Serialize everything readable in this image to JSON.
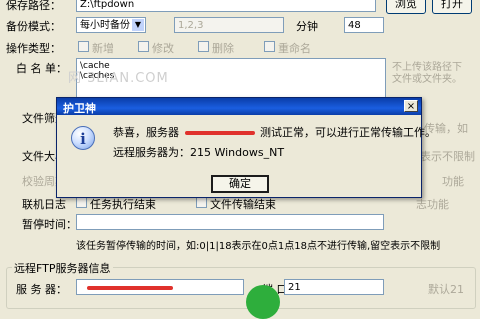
{
  "form": {
    "save_path_label": "保存路径：",
    "save_path_value": "Z:\\ftpdown",
    "browse_label": "浏览",
    "open_label": "打开",
    "backup_mode_label": "备份模式：",
    "backup_mode_value": "每小时备份",
    "backup_times_value": "1,2,3",
    "minute_label": "分钟",
    "minute_value": "48",
    "op_type_label": "操作类型：",
    "op_new": "新增",
    "op_modify": "修改",
    "op_delete": "删除",
    "op_rename": "重命名",
    "whitelist_label": "白 名 单：",
    "whitelist_lines": [
      "\\cache",
      "\\caches"
    ],
    "whitelist_hint_1": "不上传该路径下",
    "whitelist_hint_2": "文件或文件夹。",
    "file_filter_label": "文件筛选",
    "side_note_1": "传输，如",
    "file_size_label": "文件大小",
    "side_note_2": "表示不限制",
    "verify_label": "校验周期",
    "side_note_3": "功能",
    "link_log_label": "联机日志",
    "link_opt_1": "任务执行结束",
    "link_opt_2": "文件传输结束",
    "side_note_4": "志功能",
    "pause_label": "暂停时间：",
    "pause_hint": "该任务暂停传输的时间，如:0|1|18表示在0点1点18点不进行传输,留空表示不限制",
    "remote_group_label": "远程FTP服务器信息",
    "server_label": "服 务 器：",
    "port_label": "端  口：",
    "port_value": "21",
    "default_port_hint": "默认21"
  },
  "watermark": "网 3LIAN.COM",
  "dialog": {
    "title": "护卫神",
    "close_label": "×",
    "icon_glyph": "i",
    "message_prefix": "恭喜，服务器",
    "message_suffix": "测试正常，可以进行正常传输工作。",
    "remote_line": "远程服务器为：215 Windows_NT",
    "ok_label": "确定"
  },
  "colors": {
    "dialog_title_bar": "#0a3da8",
    "window_bg": "#ece9d8",
    "redaction": "#e0312c"
  }
}
